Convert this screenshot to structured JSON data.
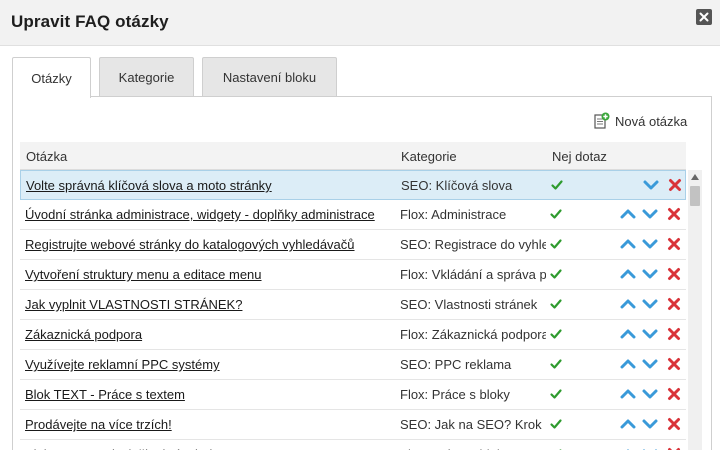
{
  "dialog": {
    "title": "Upravit FAQ otázky"
  },
  "tabs": [
    {
      "label": "Otázky",
      "active": true
    },
    {
      "label": "Kategorie",
      "active": false
    },
    {
      "label": "Nastavení bloku",
      "active": false
    }
  ],
  "toolbar": {
    "new_question_label": "Nová otázka"
  },
  "grid": {
    "columns": {
      "question": "Otázka",
      "category": "Kategorie",
      "top_question": "Nej dotaz"
    },
    "rows": [
      {
        "question": "Volte správná klíčová slova a moto stránky",
        "category": "SEO: Klíčová slova",
        "top": true,
        "selected": true
      },
      {
        "question": "Úvodní stránka administrace, widgety - doplňky administrace",
        "category": "Flox: Administrace",
        "top": true,
        "selected": false
      },
      {
        "question": "Registrujte webové stránky do katalogových vyhledávačů",
        "category": "SEO: Registrace do vyhledávačů",
        "top": true,
        "selected": false
      },
      {
        "question": "Vytvoření struktury menu a editace menu",
        "category": "Flox: Vkládání a správa položek",
        "top": true,
        "selected": false
      },
      {
        "question": "Jak vyplnit VLASTNOSTI STRÁNEK?",
        "category": "SEO: Vlastnosti stránek",
        "top": true,
        "selected": false
      },
      {
        "question": "Zákaznická podpora",
        "category": "Flox: Zákaznická podpora",
        "top": true,
        "selected": false
      },
      {
        "question": "Využívejte reklamní PPC systémy",
        "category": "SEO: PPC reklama",
        "top": true,
        "selected": false
      },
      {
        "question": "Blok TEXT - Práce s textem",
        "category": "Flox: Práce s bloky",
        "top": true,
        "selected": false
      },
      {
        "question": "Prodávejte na více trzích!",
        "category": "SEO: Jak na SEO? Krok po kroku",
        "top": true,
        "selected": false
      },
      {
        "question": "Blok TEXT - Jak vložit obrázek do textu?",
        "category": "Flox: Práce s bloky",
        "top": true,
        "selected": false
      }
    ]
  },
  "colors": {
    "accent_blue": "#3a9ad9",
    "delete_red": "#d9343a",
    "check_green": "#2e9b2e",
    "selected_row": "#dcedf7"
  }
}
